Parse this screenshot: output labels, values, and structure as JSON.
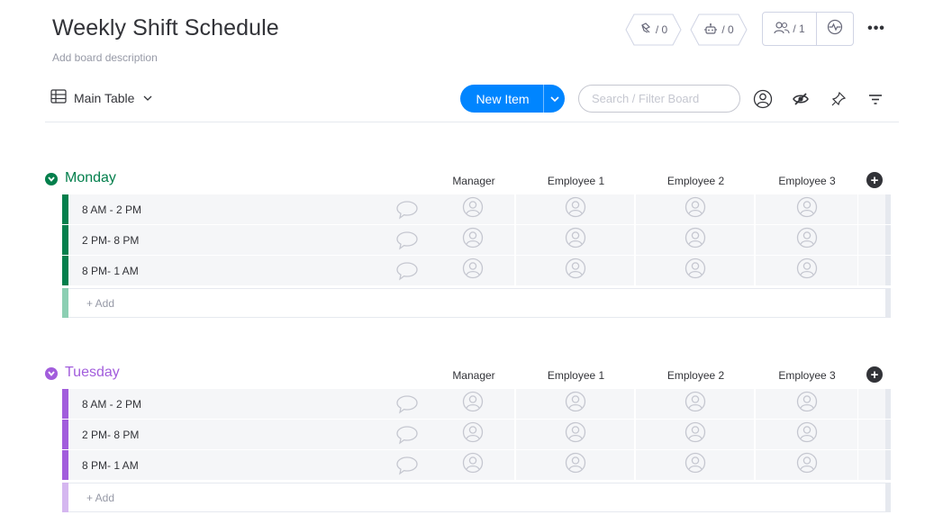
{
  "board": {
    "title": "Weekly Shift Schedule",
    "description": "Add board description"
  },
  "header": {
    "integrations_count": "/ 0",
    "automations_count": "/ 0",
    "members_count": "/ 1",
    "more_label": "•••"
  },
  "toolbar": {
    "view_label": "Main Table",
    "new_item_label": "New Item",
    "search_placeholder": "Search / Filter Board"
  },
  "columns": [
    "Manager",
    "Employee 1",
    "Employee 2",
    "Employee 3"
  ],
  "groups": [
    {
      "title": "Monday",
      "color": "#037f4c",
      "light_color": "#8ccfb3",
      "items": [
        "8 AM - 2 PM",
        "2 PM- 8 PM",
        "8 PM- 1 AM"
      ],
      "add_label": "+ Add"
    },
    {
      "title": "Tuesday",
      "color": "#a25ddc",
      "light_color": "#d5b7f0",
      "items": [
        "8 AM - 2 PM",
        "2 PM- 8 PM",
        "8 PM- 1 AM"
      ],
      "add_label": "+ Add"
    }
  ],
  "colors": {
    "primary": "#0085ff",
    "text": "#323338",
    "muted": "#9699a6",
    "row_bg": "#f5f6f8",
    "border": "#e6e9ef"
  },
  "icons": {
    "table": "table-icon",
    "integrations": "integrations-icon",
    "automations": "robot-icon",
    "members": "members-icon",
    "activity": "activity-icon",
    "person_filter": "person-icon",
    "hide": "eye-slash-icon",
    "pin": "pin-icon",
    "filter": "filter-icon",
    "chat": "chat-bubble-icon",
    "person": "person-avatar-icon"
  }
}
